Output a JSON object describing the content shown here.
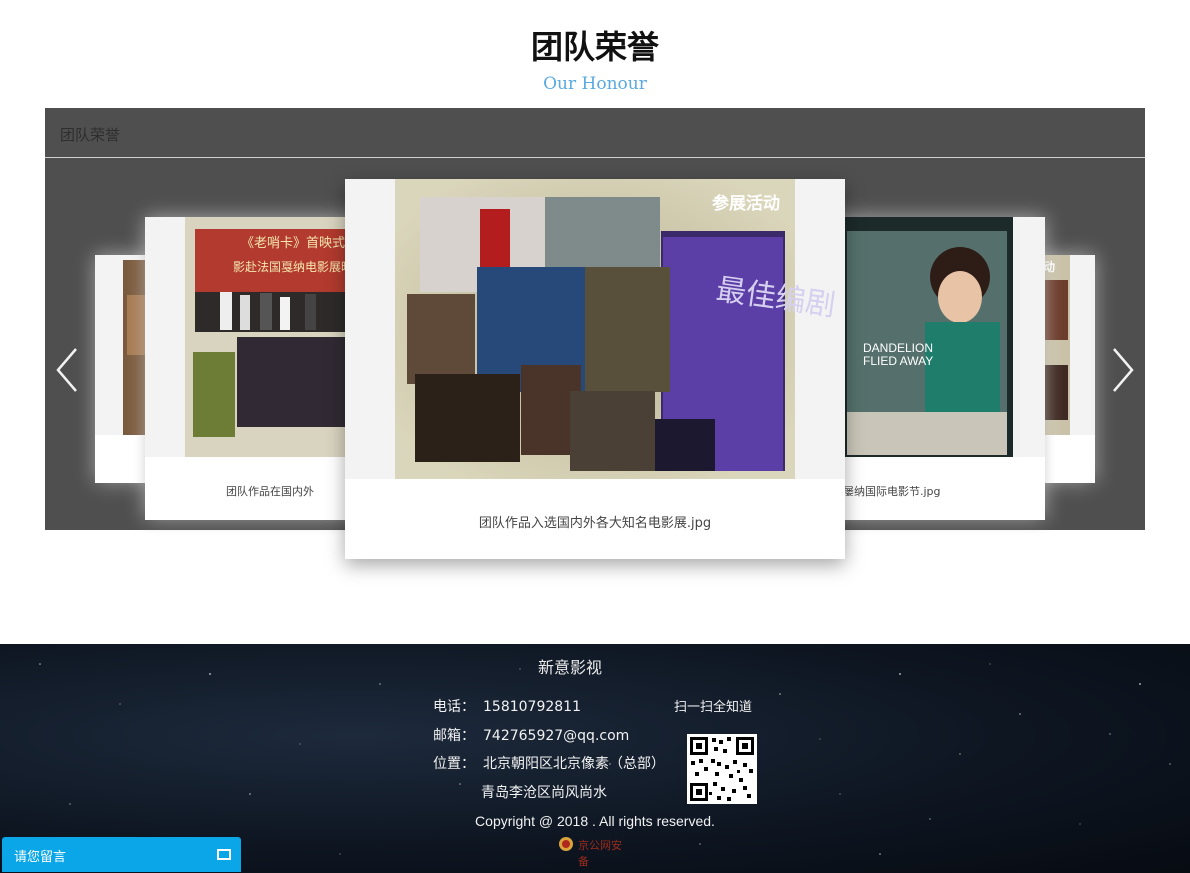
{
  "section": {
    "title_cn": "团队荣誉",
    "title_en": "Our Honour"
  },
  "panel": {
    "header": "团队荣誉"
  },
  "carousel": {
    "prev_icon": "chevron-left-icon",
    "next_icon": "chevron-right-icon",
    "cards": {
      "left_caption": "团队作品在国内外",
      "center_caption": "团队作品入选国内外各大知名电影展.jpg",
      "right_caption": "屡纳国际电影节.jpg",
      "center_image_heading": "参展活动",
      "center_image_overlay": "最佳编剧",
      "left_image_heading": "《老哨卡》首映式",
      "left_image_sub": "影赴法国戛纳电影展映",
      "right_image_title_1": "DANDELION",
      "right_image_title_2": "FLIED AWAY",
      "far_right_image_heading": "活动"
    }
  },
  "footer": {
    "brand": "新意影视",
    "phone_label": "电话：",
    "phone": "15810792811",
    "email_label": "邮箱：",
    "email": "742765927@qq.com",
    "location_label": "位置：",
    "location_1": "北京朝阳区北京像素（总部）",
    "location_2": "青岛李沧区尚风尚水",
    "scan_text": "扫一扫全知道",
    "copyright": "Copyright @ 2018 . All rights reserved.",
    "police_text": "京公网安备"
  },
  "message_bar": {
    "label": "请您留言",
    "icon": "maximize-icon"
  },
  "colors": {
    "accent_blue": "#5aa9e0",
    "panel_bg": "#4f4f4f",
    "message_bar": "#0aa6e8"
  }
}
